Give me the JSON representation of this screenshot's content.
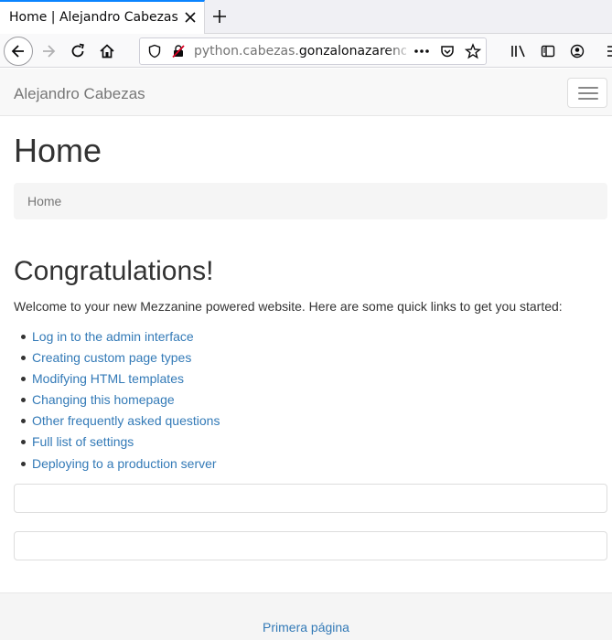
{
  "browser": {
    "tab_title": "Home | Alejandro Cabezas",
    "url_prefix": "python.cabezas.",
    "url_host": "gonzalonazareno.",
    "icons": [
      "close-icon",
      "plus-icon",
      "back-arrow-icon",
      "forward-arrow-icon",
      "reload-icon",
      "home-icon",
      "shield-icon",
      "insecure-lock-icon",
      "more-icon",
      "pocket-icon",
      "star-icon",
      "library-icon",
      "sidebar-icon",
      "account-icon",
      "menu-icon"
    ]
  },
  "site": {
    "brand": "Alejandro Cabezas",
    "page_title": "Home",
    "breadcrumb": "Home",
    "heading": "Congratulations!",
    "welcome": "Welcome to your new Mezzanine powered website. Here are some quick links to get you started:",
    "links": [
      "Log in to the admin interface",
      "Creating custom page types",
      "Modifying HTML templates",
      "Changing this homepage",
      "Other frequently asked questions",
      "Full list of settings",
      "Deploying to a production server"
    ],
    "footer_link": "Primera página"
  },
  "colors": {
    "link": "#337ab7",
    "accent_tab": "#0a84ff",
    "brand_text": "#777777"
  }
}
